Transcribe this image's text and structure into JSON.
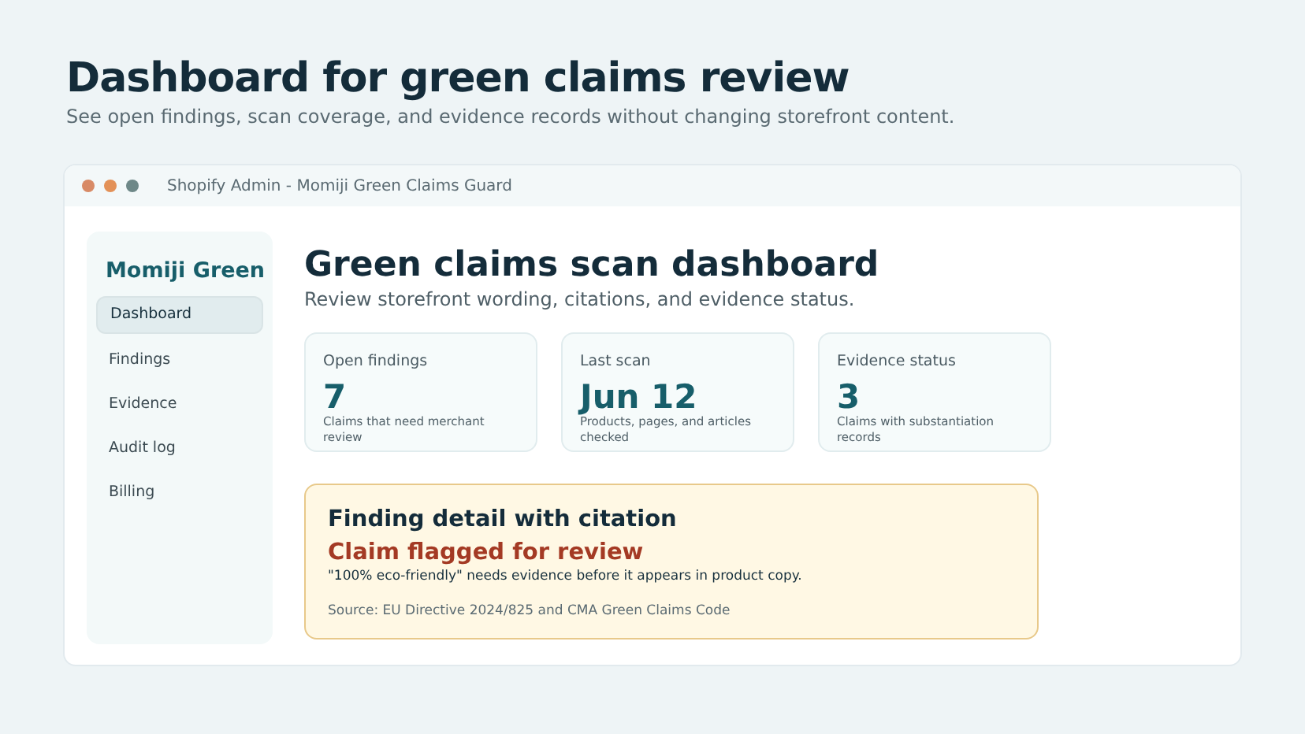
{
  "page": {
    "title": "Dashboard for green claims review",
    "subtitle": "See open findings, scan coverage, and evidence records without changing storefront content."
  },
  "window": {
    "title": "Shopify Admin - Momiji Green Claims Guard"
  },
  "sidebar": {
    "brand": "Momiji Green",
    "items": [
      {
        "label": "Dashboard",
        "selected": true
      },
      {
        "label": "Findings",
        "selected": false
      },
      {
        "label": "Evidence",
        "selected": false
      },
      {
        "label": "Audit log",
        "selected": false
      },
      {
        "label": "Billing",
        "selected": false
      }
    ]
  },
  "main": {
    "title": "Green claims scan dashboard",
    "subtitle": "Review storefront wording, citations, and evidence status.",
    "cards": [
      {
        "label": "Open findings",
        "value": "7",
        "note": "Claims that need merchant review"
      },
      {
        "label": "Last scan",
        "value": "Jun 12",
        "note": "Products, pages, and articles checked"
      },
      {
        "label": "Evidence status",
        "value": "3",
        "note": "Claims with substantiation records"
      }
    ],
    "finding": {
      "title": "Finding detail with citation",
      "heading": "Claim flagged for review",
      "text": "\"100% eco-friendly\" needs evidence before it appears in product copy.",
      "source": "Source: EU Directive 2024/825 and CMA Green Claims Code"
    }
  }
}
